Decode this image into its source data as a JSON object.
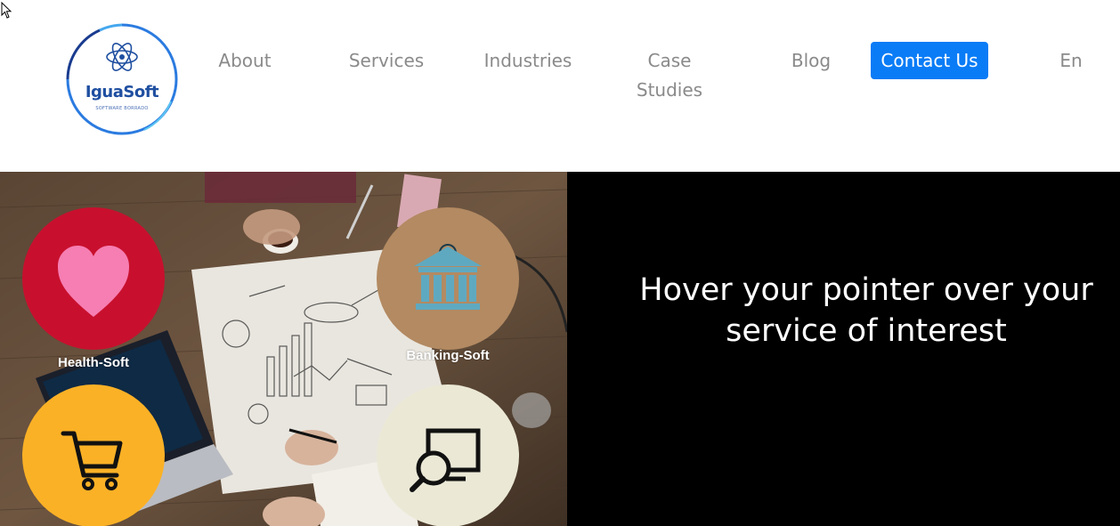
{
  "header": {
    "logo": {
      "name": "IguaSoft",
      "tagline": "SOFTWARE BORRADO",
      "icon": "atom-icon"
    },
    "nav": {
      "about": "About",
      "services": "Services",
      "industries": "Industries",
      "case_studies_line1": "Case",
      "case_studies_line2": "Studies",
      "blog": "Blog",
      "contact": "Contact Us",
      "language": "En"
    }
  },
  "hero": {
    "headline_line1": "Hover your pointer over your",
    "headline_line2": "service of interest",
    "services": [
      {
        "label": "Health-Soft",
        "icon": "heart-icon",
        "color": "#c8102e"
      },
      {
        "label": "Banking-Soft",
        "icon": "bank-icon",
        "color": "#b38a62"
      },
      {
        "label": "",
        "icon": "shopping-cart-icon",
        "color": "#fbb126"
      },
      {
        "label": "",
        "icon": "monitor-search-icon",
        "color": "#ebe9d6"
      }
    ]
  },
  "colors": {
    "accent": "#0a7cf6",
    "nav_text": "#8a8a8a",
    "hero_background": "#000000"
  }
}
